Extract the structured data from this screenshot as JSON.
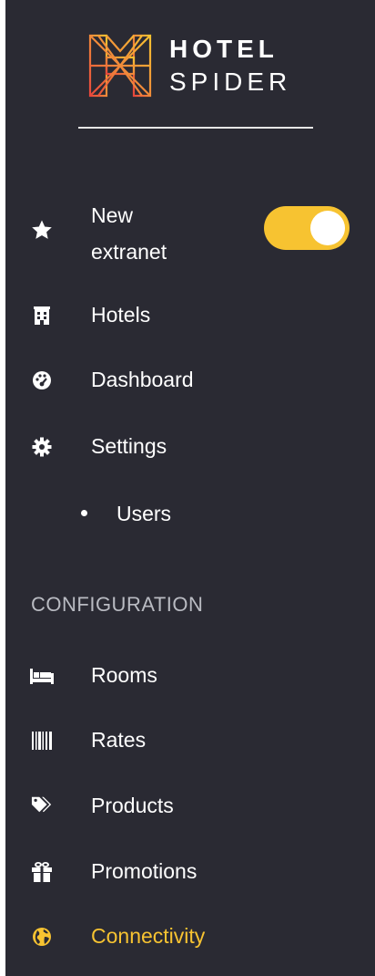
{
  "brand": {
    "line1": "HOTEL",
    "line2": "SPIDER",
    "accent": "#f7c331"
  },
  "nav": {
    "new_extranet": {
      "label_line1": "New",
      "label_line2": "extranet",
      "icon": "star-icon",
      "toggle_on": true
    },
    "hotels": {
      "label": "Hotels",
      "icon": "building-icon"
    },
    "dashboard": {
      "label": "Dashboard",
      "icon": "dashboard-icon"
    },
    "settings": {
      "label": "Settings",
      "icon": "gear-icon"
    },
    "users": {
      "label": "Users"
    }
  },
  "configuration": {
    "header": "CONFIGURATION",
    "items": [
      {
        "label": "Rooms",
        "icon": "bed-icon"
      },
      {
        "label": "Rates",
        "icon": "barcode-icon"
      },
      {
        "label": "Products",
        "icon": "tags-icon"
      },
      {
        "label": "Promotions",
        "icon": "gift-icon"
      },
      {
        "label": "Connectivity",
        "icon": "globe-icon",
        "active": true
      }
    ]
  }
}
